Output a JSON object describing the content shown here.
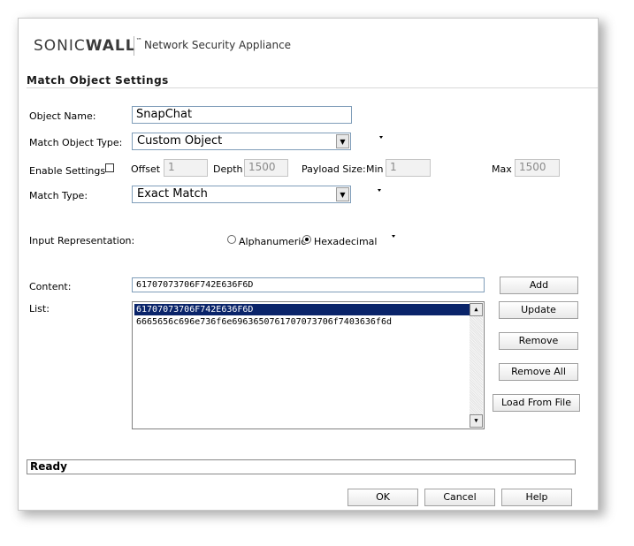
{
  "header": {
    "brand_sonic": "SONIC",
    "brand_wall": "WALL",
    "brand_tm": "™",
    "subtitle": "Network Security Appliance"
  },
  "section_title": "Match Object Settings",
  "form": {
    "object_name": {
      "label": "Object Name:",
      "value": "SnapChat"
    },
    "match_object_type": {
      "label": "Match Object Type:",
      "value": "Custom Object"
    },
    "enable_settings": {
      "label": "Enable Settings",
      "offset_label": "Offset",
      "offset_value": "1",
      "depth_label": "Depth",
      "depth_value": "1500",
      "payload_label": "Payload Size:",
      "min_label": "Min",
      "min_value": "1",
      "max_label": "Max",
      "max_value": "1500"
    },
    "match_type": {
      "label": "Match Type:",
      "value": "Exact Match"
    },
    "input_representation": {
      "label": "Input Representation:",
      "option_alpha": "Alphanumeric",
      "option_hex": "Hexadecimal",
      "selected": "Hexadecimal"
    },
    "content": {
      "label": "Content:",
      "value": "61707073706F742E636F6D"
    },
    "list": {
      "label": "List:",
      "items": [
        "61707073706F742E636F6D",
        "6665656c696e736f6e6963650761707073706f7403636f6d"
      ]
    }
  },
  "buttons": {
    "add": "Add",
    "update": "Update",
    "remove": "Remove",
    "remove_all": "Remove All",
    "load_from_file": "Load From File",
    "ok": "OK",
    "cancel": "Cancel",
    "help": "Help"
  },
  "status": "Ready",
  "colors": {
    "selection": "#0a246a",
    "field_border": "#7f9db9"
  }
}
